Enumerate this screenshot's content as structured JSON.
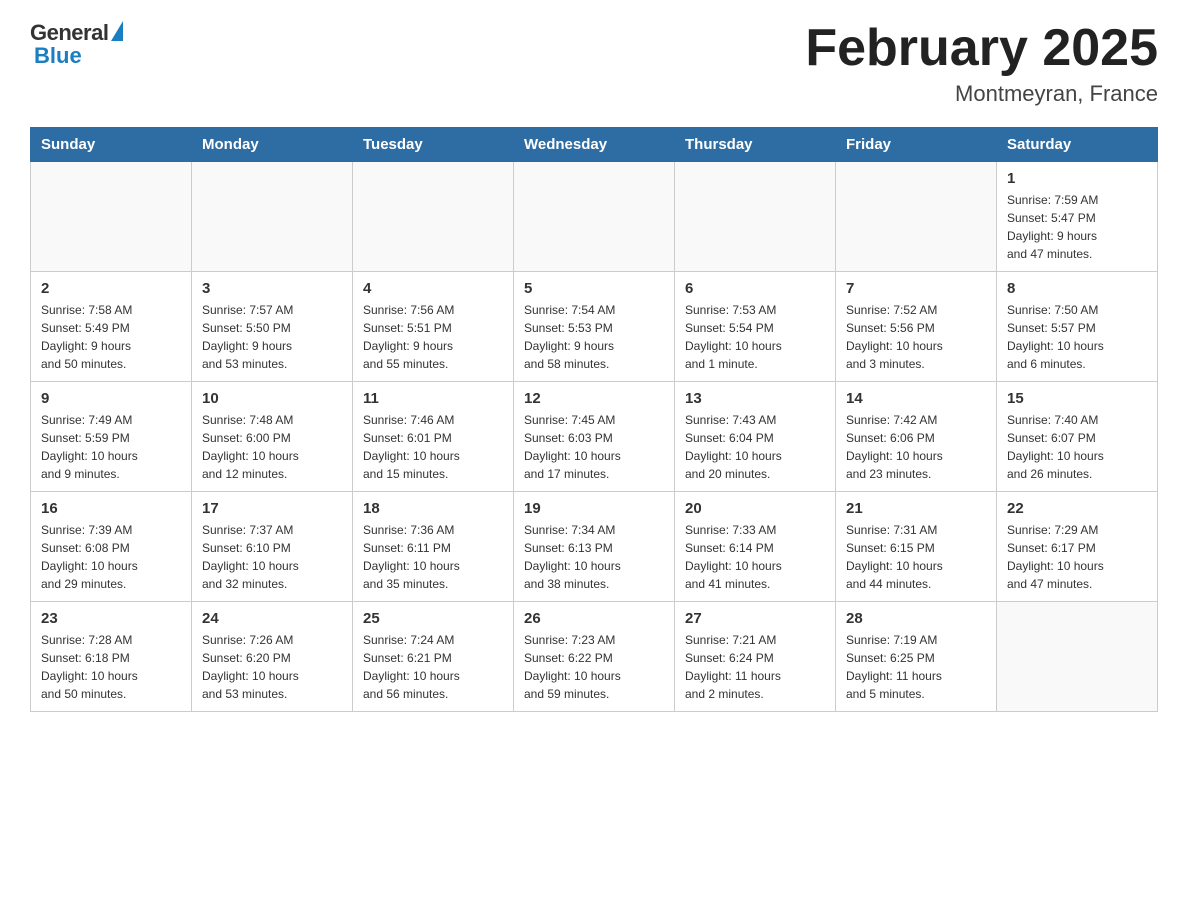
{
  "header": {
    "logo_general": "General",
    "logo_blue": "Blue",
    "title": "February 2025",
    "subtitle": "Montmeyran, France"
  },
  "days_of_week": [
    "Sunday",
    "Monday",
    "Tuesday",
    "Wednesday",
    "Thursday",
    "Friday",
    "Saturday"
  ],
  "weeks": [
    [
      {
        "day": "",
        "info": ""
      },
      {
        "day": "",
        "info": ""
      },
      {
        "day": "",
        "info": ""
      },
      {
        "day": "",
        "info": ""
      },
      {
        "day": "",
        "info": ""
      },
      {
        "day": "",
        "info": ""
      },
      {
        "day": "1",
        "info": "Sunrise: 7:59 AM\nSunset: 5:47 PM\nDaylight: 9 hours\nand 47 minutes."
      }
    ],
    [
      {
        "day": "2",
        "info": "Sunrise: 7:58 AM\nSunset: 5:49 PM\nDaylight: 9 hours\nand 50 minutes."
      },
      {
        "day": "3",
        "info": "Sunrise: 7:57 AM\nSunset: 5:50 PM\nDaylight: 9 hours\nand 53 minutes."
      },
      {
        "day": "4",
        "info": "Sunrise: 7:56 AM\nSunset: 5:51 PM\nDaylight: 9 hours\nand 55 minutes."
      },
      {
        "day": "5",
        "info": "Sunrise: 7:54 AM\nSunset: 5:53 PM\nDaylight: 9 hours\nand 58 minutes."
      },
      {
        "day": "6",
        "info": "Sunrise: 7:53 AM\nSunset: 5:54 PM\nDaylight: 10 hours\nand 1 minute."
      },
      {
        "day": "7",
        "info": "Sunrise: 7:52 AM\nSunset: 5:56 PM\nDaylight: 10 hours\nand 3 minutes."
      },
      {
        "day": "8",
        "info": "Sunrise: 7:50 AM\nSunset: 5:57 PM\nDaylight: 10 hours\nand 6 minutes."
      }
    ],
    [
      {
        "day": "9",
        "info": "Sunrise: 7:49 AM\nSunset: 5:59 PM\nDaylight: 10 hours\nand 9 minutes."
      },
      {
        "day": "10",
        "info": "Sunrise: 7:48 AM\nSunset: 6:00 PM\nDaylight: 10 hours\nand 12 minutes."
      },
      {
        "day": "11",
        "info": "Sunrise: 7:46 AM\nSunset: 6:01 PM\nDaylight: 10 hours\nand 15 minutes."
      },
      {
        "day": "12",
        "info": "Sunrise: 7:45 AM\nSunset: 6:03 PM\nDaylight: 10 hours\nand 17 minutes."
      },
      {
        "day": "13",
        "info": "Sunrise: 7:43 AM\nSunset: 6:04 PM\nDaylight: 10 hours\nand 20 minutes."
      },
      {
        "day": "14",
        "info": "Sunrise: 7:42 AM\nSunset: 6:06 PM\nDaylight: 10 hours\nand 23 minutes."
      },
      {
        "day": "15",
        "info": "Sunrise: 7:40 AM\nSunset: 6:07 PM\nDaylight: 10 hours\nand 26 minutes."
      }
    ],
    [
      {
        "day": "16",
        "info": "Sunrise: 7:39 AM\nSunset: 6:08 PM\nDaylight: 10 hours\nand 29 minutes."
      },
      {
        "day": "17",
        "info": "Sunrise: 7:37 AM\nSunset: 6:10 PM\nDaylight: 10 hours\nand 32 minutes."
      },
      {
        "day": "18",
        "info": "Sunrise: 7:36 AM\nSunset: 6:11 PM\nDaylight: 10 hours\nand 35 minutes."
      },
      {
        "day": "19",
        "info": "Sunrise: 7:34 AM\nSunset: 6:13 PM\nDaylight: 10 hours\nand 38 minutes."
      },
      {
        "day": "20",
        "info": "Sunrise: 7:33 AM\nSunset: 6:14 PM\nDaylight: 10 hours\nand 41 minutes."
      },
      {
        "day": "21",
        "info": "Sunrise: 7:31 AM\nSunset: 6:15 PM\nDaylight: 10 hours\nand 44 minutes."
      },
      {
        "day": "22",
        "info": "Sunrise: 7:29 AM\nSunset: 6:17 PM\nDaylight: 10 hours\nand 47 minutes."
      }
    ],
    [
      {
        "day": "23",
        "info": "Sunrise: 7:28 AM\nSunset: 6:18 PM\nDaylight: 10 hours\nand 50 minutes."
      },
      {
        "day": "24",
        "info": "Sunrise: 7:26 AM\nSunset: 6:20 PM\nDaylight: 10 hours\nand 53 minutes."
      },
      {
        "day": "25",
        "info": "Sunrise: 7:24 AM\nSunset: 6:21 PM\nDaylight: 10 hours\nand 56 minutes."
      },
      {
        "day": "26",
        "info": "Sunrise: 7:23 AM\nSunset: 6:22 PM\nDaylight: 10 hours\nand 59 minutes."
      },
      {
        "day": "27",
        "info": "Sunrise: 7:21 AM\nSunset: 6:24 PM\nDaylight: 11 hours\nand 2 minutes."
      },
      {
        "day": "28",
        "info": "Sunrise: 7:19 AM\nSunset: 6:25 PM\nDaylight: 11 hours\nand 5 minutes."
      },
      {
        "day": "",
        "info": ""
      }
    ]
  ]
}
